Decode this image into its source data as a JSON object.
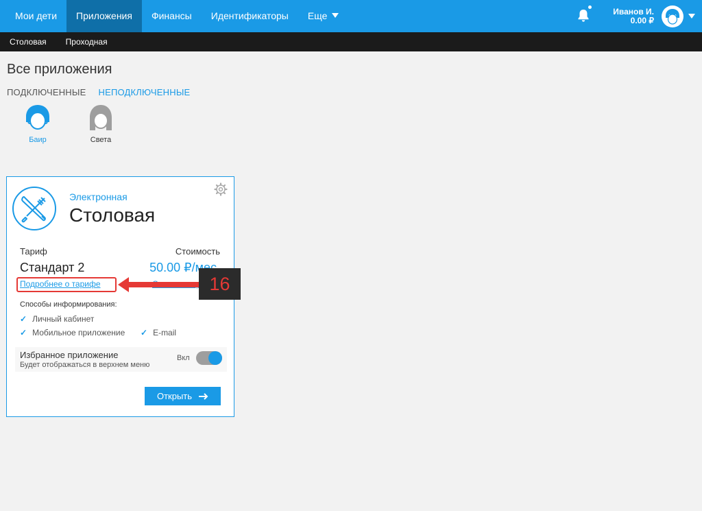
{
  "nav": {
    "items": [
      "Мои дети",
      "Приложения",
      "Финансы",
      "Идентификаторы"
    ],
    "more_label": "Еще",
    "active_index": 1
  },
  "user": {
    "name": "Иванов И.",
    "balance": "0.00 ₽"
  },
  "subnav": {
    "items": [
      "Столовая",
      "Проходная"
    ]
  },
  "page": {
    "title": "Все приложения",
    "tab_connected": "ПОДКЛЮЧЕННЫЕ",
    "tab_disconnected": "НЕПОДКЛЮЧЕННЫЕ"
  },
  "children": [
    {
      "name": "Баир",
      "color": "#1a9ae6"
    },
    {
      "name": "Света",
      "color": "#333333"
    }
  ],
  "card": {
    "subtitle": "Электронная",
    "title": "Столовая",
    "tariff_label": "Тариф",
    "cost_label": "Стоимость",
    "tariff_name": "Стандарт 2",
    "price": "50.00 ₽/мес.",
    "more_link": "Подробнее о тарифе",
    "change_link": "Сменить тариф",
    "notify_title": "Способы информирования:",
    "notify": [
      "Личный кабинет",
      "Мобильное приложение",
      "E-mail"
    ],
    "fav_title": "Избранное приложение",
    "fav_desc": "Будет отображаться в верхнем меню",
    "toggle_label": "Вкл",
    "toggle_on": true,
    "open_button": "Открыть"
  },
  "annotation": {
    "step": "16"
  },
  "colors": {
    "accent": "#1a9ae6",
    "nav_active": "#0f6fa8",
    "subbar": "#1b1b1b",
    "annotation": "#e53935"
  }
}
